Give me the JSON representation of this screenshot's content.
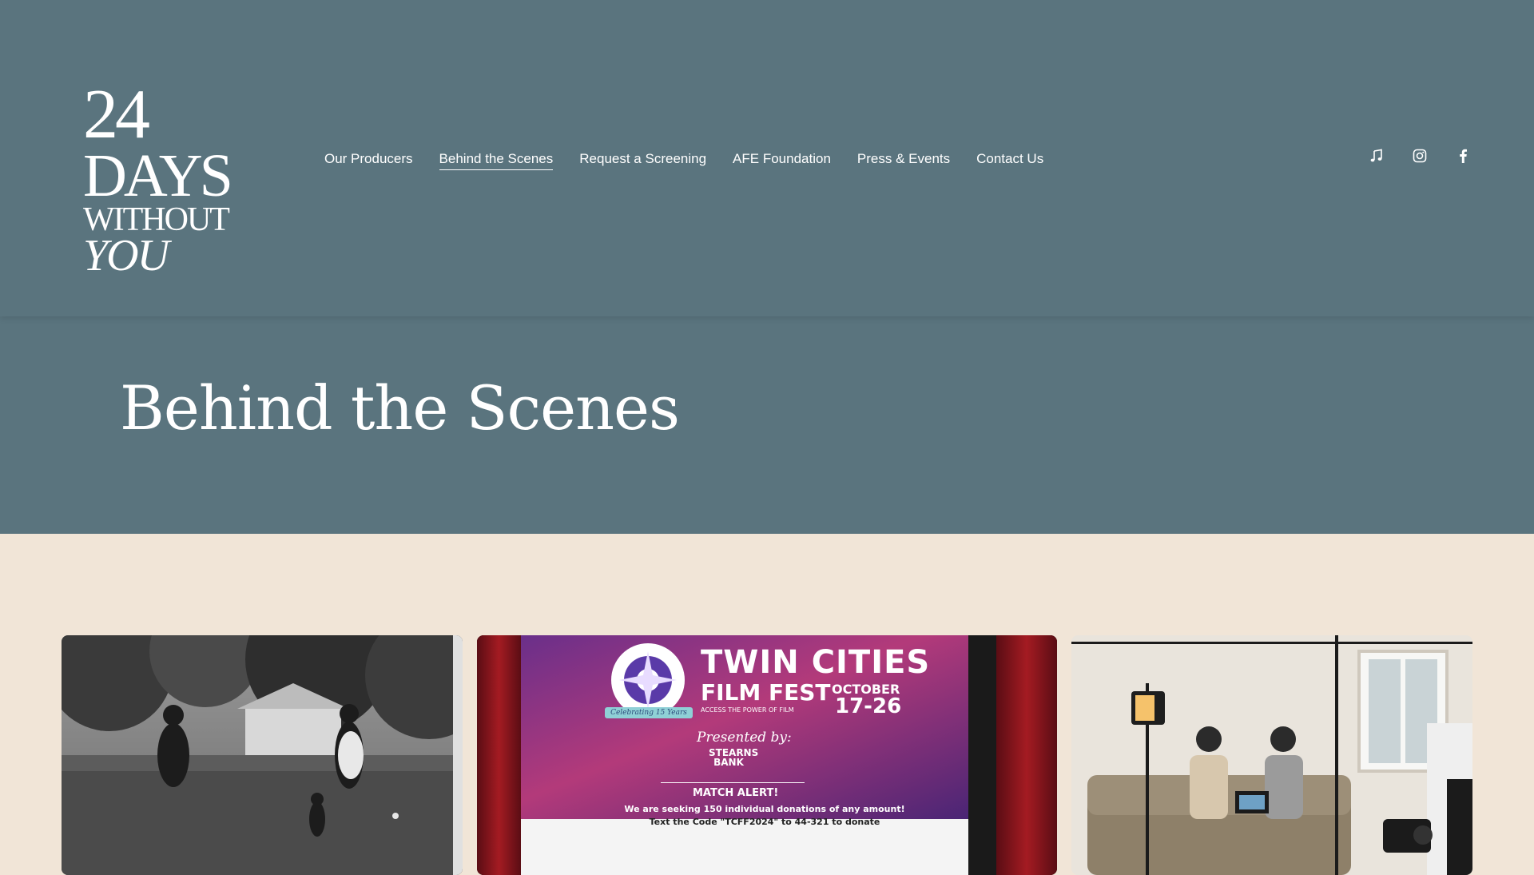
{
  "logo": {
    "line1": "24",
    "line2": "DAYS",
    "line3": "WITHOUT",
    "line4": "YOU"
  },
  "nav": {
    "items": [
      {
        "label": "Our Producers"
      },
      {
        "label": "Behind the Scenes",
        "active": true
      },
      {
        "label": "Request a Screening"
      },
      {
        "label": "AFE Foundation"
      },
      {
        "label": "Press & Events"
      },
      {
        "label": "Contact Us"
      }
    ]
  },
  "social": {
    "icons": [
      "music-note-icon",
      "instagram-icon",
      "facebook-icon"
    ]
  },
  "hero": {
    "title": "Behind the Scenes"
  },
  "gallery": {
    "card2": {
      "festival_line1": "TWIN CITIES",
      "festival_line2": "FILM FEST",
      "dates_month": "OCTOBER",
      "dates_days": "17-26",
      "tagline": "ACCESS THE POWER OF FILM",
      "badge": "Celebrating 15 Years",
      "presented_by": "Presented by:",
      "sponsor": "STEARNS BANK",
      "alert": "MATCH ALERT!",
      "donation_line1": "We are seeking 150 individual donations of any amount!",
      "donation_line2": "Text the Code \"TCFF2024\" to 44-321 to donate"
    }
  },
  "colors": {
    "header_bg": "#5a747e",
    "page_bg": "#f1e5d7",
    "text_light": "#ffffff"
  }
}
